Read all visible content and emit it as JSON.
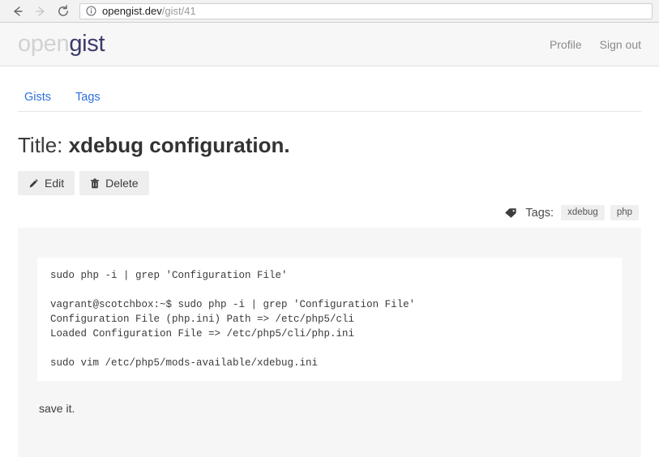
{
  "browser": {
    "back_label": "Back",
    "forward_label": "Forward",
    "reload_label": "Reload",
    "url_domain": "opengist.dev",
    "url_path": "/gist/41",
    "info_icon": "info-circle-icon"
  },
  "header": {
    "logo_first": "open",
    "logo_second": "gist",
    "links": [
      {
        "label": "Profile"
      },
      {
        "label": "Sign out"
      }
    ]
  },
  "nav": {
    "tabs": [
      {
        "label": "Gists"
      },
      {
        "label": "Tags"
      }
    ]
  },
  "main": {
    "title_prefix": "Title: ",
    "title_value": "xdebug configuration.",
    "actions": [
      {
        "label": "Edit",
        "icon": "pencil-icon"
      },
      {
        "label": "Delete",
        "icon": "trash-icon"
      }
    ],
    "tags": {
      "icon": "tag-icon",
      "label": "Tags:",
      "items": [
        {
          "label": "xdebug"
        },
        {
          "label": "php"
        }
      ]
    },
    "code": "sudo php -i | grep 'Configuration File'\n\nvagrant@scotchbox:~$ sudo php -i | grep 'Configuration File'\nConfiguration File (php.ini) Path => /etc/php5/cli\nLoaded Configuration File => /etc/php5/cli/php.ini\n\nsudo vim /etc/php5/mods-available/xdebug.ini",
    "note": "save it."
  },
  "colors": {
    "link_blue": "#2f6fdd",
    "logo_dark": "#3d3b6b",
    "logo_light": "#d2d2d4",
    "panel_bg": "#f6f6f6",
    "header_bg": "#f7f7f7",
    "button_bg": "#eeeeee"
  }
}
